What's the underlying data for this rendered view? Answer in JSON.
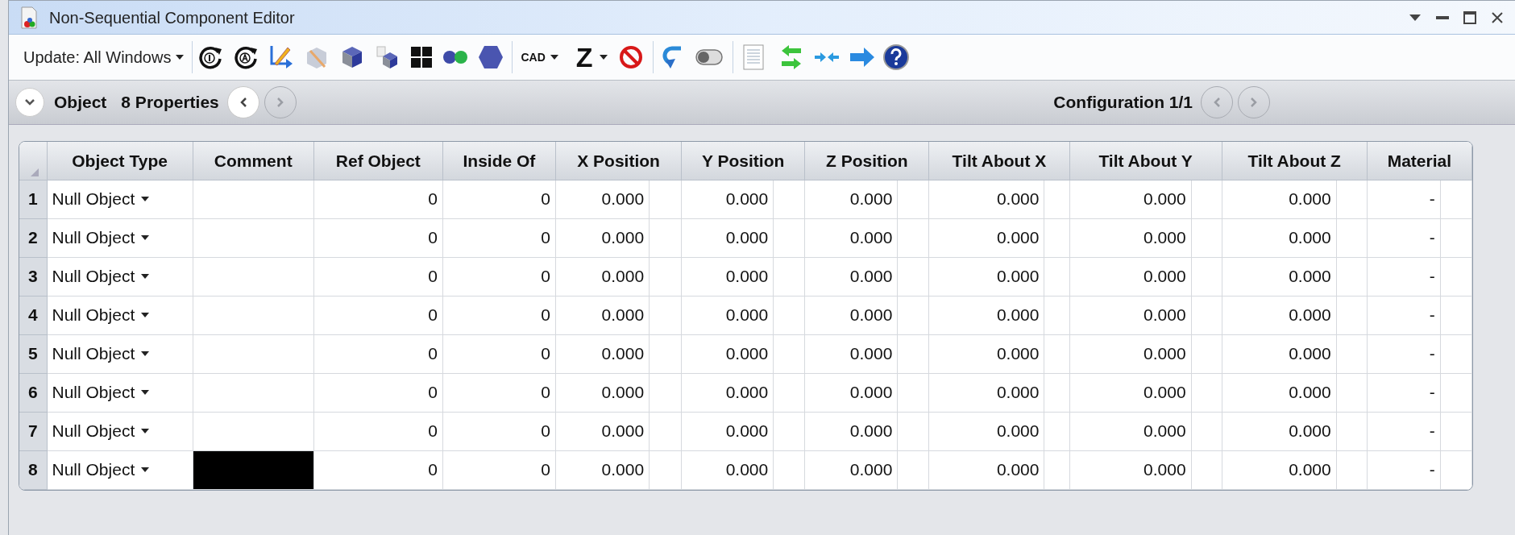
{
  "window": {
    "title": "Non-Sequential Component Editor"
  },
  "toolbar": {
    "update_dropdown": "Update: All Windows",
    "cad_button": "CAD",
    "z_button": "Z"
  },
  "properties_bar": {
    "object_label": "Object",
    "properties_label": "8 Properties",
    "prev_disabled": false,
    "next_disabled": true,
    "configuration": "Configuration 1/1",
    "config_prev_disabled": true,
    "config_next_disabled": true
  },
  "table": {
    "columns": [
      "Object Type",
      "Comment",
      "Ref Object",
      "Inside Of",
      "X Position",
      "Y Position",
      "Z Position",
      "Tilt About X",
      "Tilt About Y",
      "Tilt About Z",
      "Material"
    ],
    "rows": [
      {
        "number": "1",
        "object_type": "Null Object",
        "comment_blacked_out": false,
        "ref_object": "0",
        "inside_of": "0",
        "values": [
          "0.000",
          "0.000",
          "0.000",
          "0.000",
          "0.000",
          "0.000"
        ],
        "material": "-"
      },
      {
        "number": "2",
        "object_type": "Null Object",
        "comment_blacked_out": false,
        "ref_object": "0",
        "inside_of": "0",
        "values": [
          "0.000",
          "0.000",
          "0.000",
          "0.000",
          "0.000",
          "0.000"
        ],
        "material": "-"
      },
      {
        "number": "3",
        "object_type": "Null Object",
        "comment_blacked_out": false,
        "ref_object": "0",
        "inside_of": "0",
        "values": [
          "0.000",
          "0.000",
          "0.000",
          "0.000",
          "0.000",
          "0.000"
        ],
        "material": "-"
      },
      {
        "number": "4",
        "object_type": "Null Object",
        "comment_blacked_out": false,
        "ref_object": "0",
        "inside_of": "0",
        "values": [
          "0.000",
          "0.000",
          "0.000",
          "0.000",
          "0.000",
          "0.000"
        ],
        "material": "-"
      },
      {
        "number": "5",
        "object_type": "Null Object",
        "comment_blacked_out": false,
        "ref_object": "0",
        "inside_of": "0",
        "values": [
          "0.000",
          "0.000",
          "0.000",
          "0.000",
          "0.000",
          "0.000"
        ],
        "material": "-"
      },
      {
        "number": "6",
        "object_type": "Null Object",
        "comment_blacked_out": false,
        "ref_object": "0",
        "inside_of": "0",
        "values": [
          "0.000",
          "0.000",
          "0.000",
          "0.000",
          "0.000",
          "0.000"
        ],
        "material": "-"
      },
      {
        "number": "7",
        "object_type": "Null Object",
        "comment_blacked_out": false,
        "ref_object": "0",
        "inside_of": "0",
        "values": [
          "0.000",
          "0.000",
          "0.000",
          "0.000",
          "0.000",
          "0.000"
        ],
        "material": "-"
      },
      {
        "number": "8",
        "object_type": "Null Object",
        "comment_blacked_out": true,
        "ref_object": "0",
        "inside_of": "0",
        "values": [
          "0.000",
          "0.000",
          "0.000",
          "0.000",
          "0.000",
          "0.000"
        ],
        "material": "-"
      }
    ]
  }
}
